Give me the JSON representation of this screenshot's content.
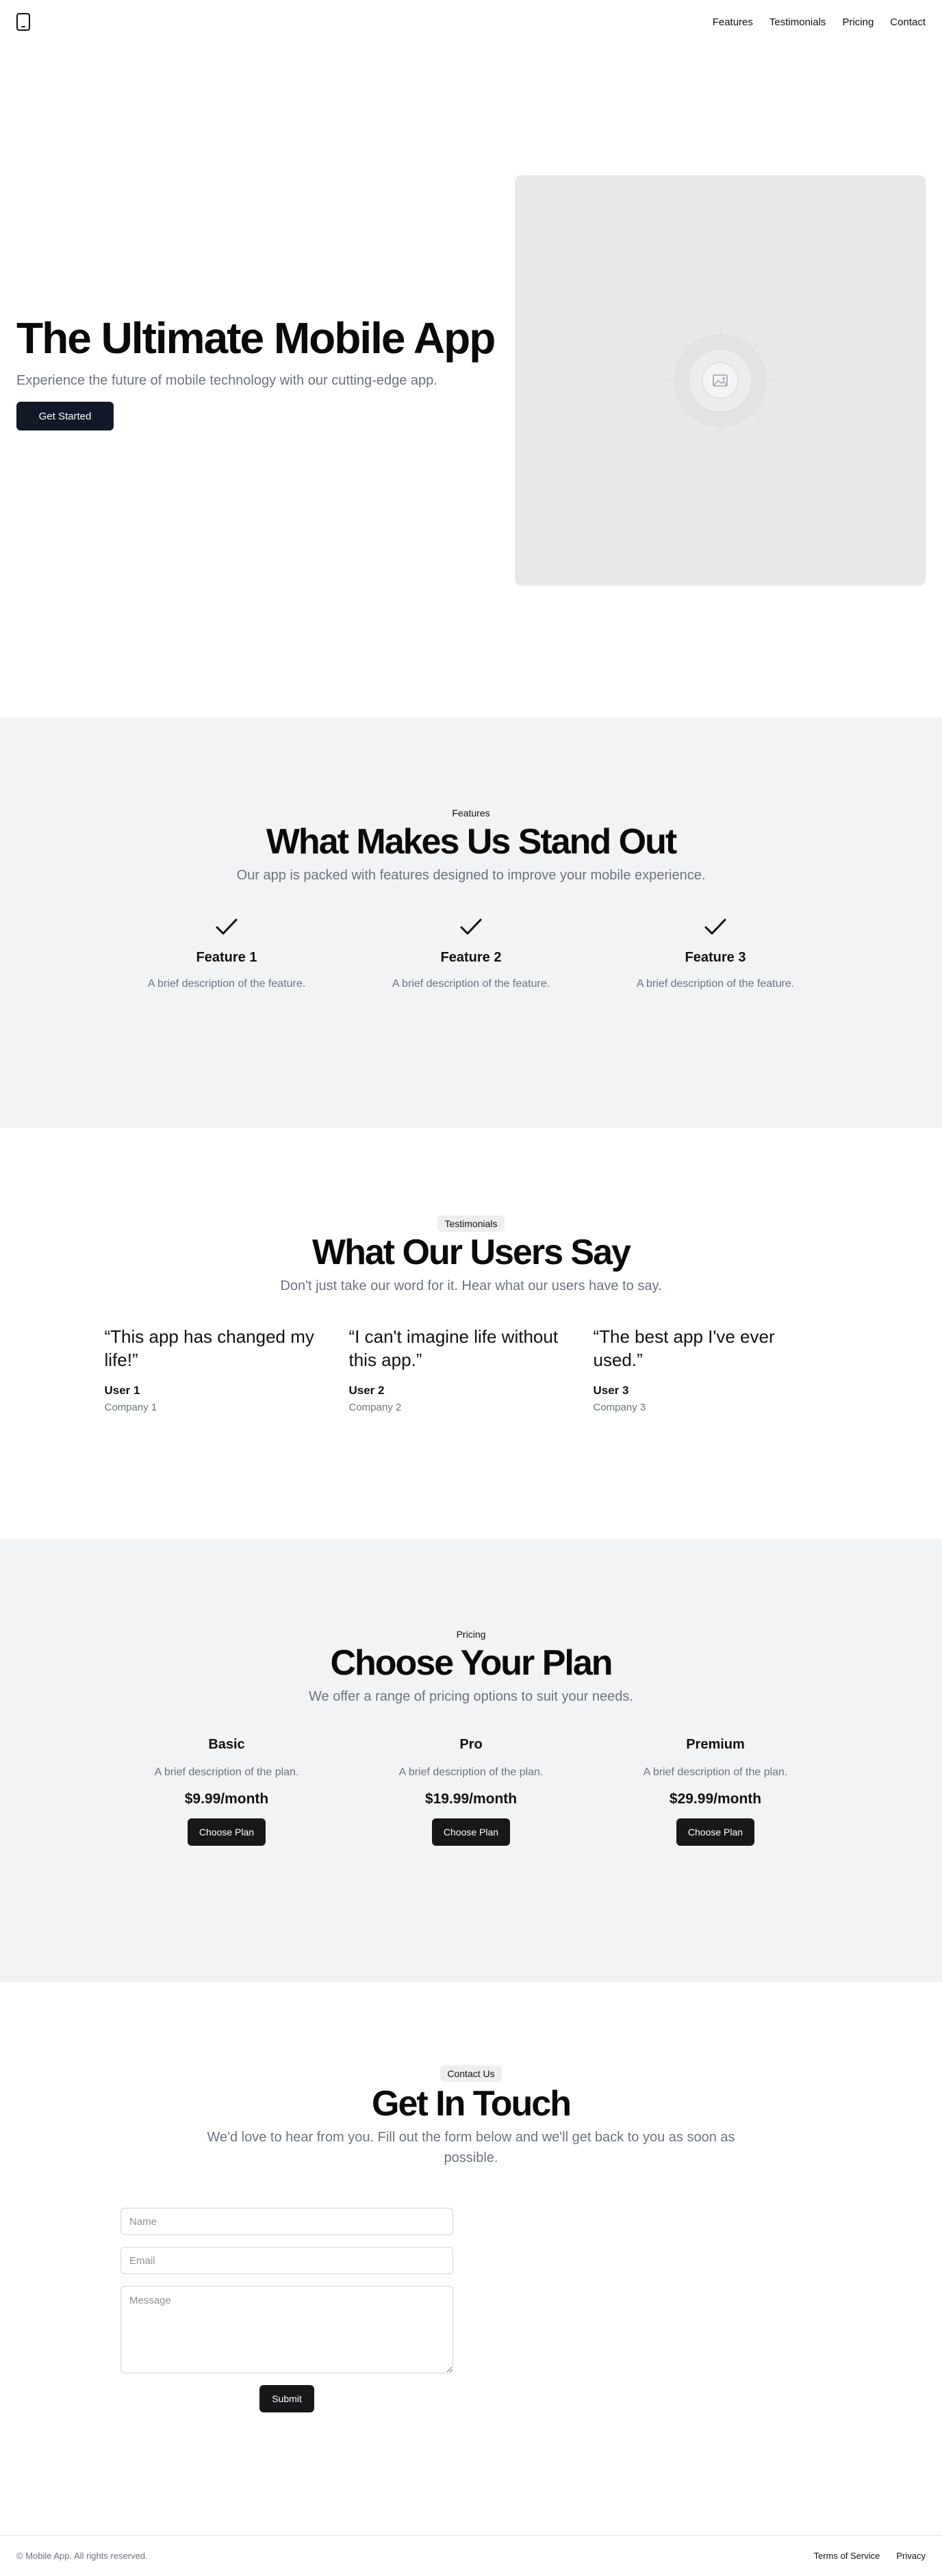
{
  "header": {
    "nav": [
      "Features",
      "Testimonials",
      "Pricing",
      "Contact"
    ]
  },
  "hero": {
    "title": "The Ultimate Mobile App",
    "subtitle": "Experience the future of mobile technology with our cutting-edge app.",
    "cta": "Get Started",
    "image_icon": "image-placeholder-icon"
  },
  "features": {
    "eyebrow": "Features",
    "title": "What Makes Us Stand Out",
    "subtitle": "Our app is packed with features designed to improve your mobile experience.",
    "items": [
      {
        "icon": "check-icon",
        "title": "Feature 1",
        "description": "A brief description of the feature."
      },
      {
        "icon": "check-icon",
        "title": "Feature 2",
        "description": "A brief description of the feature."
      },
      {
        "icon": "check-icon",
        "title": "Feature 3",
        "description": "A brief description of the feature."
      }
    ]
  },
  "testimonials": {
    "eyebrow": "Testimonials",
    "title": "What Our Users Say",
    "subtitle": "Don't just take our word for it. Hear what our users have to say.",
    "items": [
      {
        "quote": "“This app has changed my life!”",
        "name": "User 1",
        "company": "Company 1"
      },
      {
        "quote": "“I can't imagine life without this app.”",
        "name": "User 2",
        "company": "Company 2"
      },
      {
        "quote": "“The best app I've ever used.”",
        "name": "User 3",
        "company": "Company 3"
      }
    ]
  },
  "pricing": {
    "eyebrow": "Pricing",
    "title": "Choose Your Plan",
    "subtitle": "We offer a range of pricing options to suit your needs.",
    "plans": [
      {
        "name": "Basic",
        "description": "A brief description of the plan.",
        "price": "$9.99/month",
        "cta": "Choose Plan"
      },
      {
        "name": "Pro",
        "description": "A brief description of the plan.",
        "price": "$19.99/month",
        "cta": "Choose Plan"
      },
      {
        "name": "Premium",
        "description": "A brief description of the plan.",
        "price": "$29.99/month",
        "cta": "Choose Plan"
      }
    ]
  },
  "contact": {
    "eyebrow": "Contact Us",
    "title": "Get In Touch",
    "subtitle": "We'd love to hear from you. Fill out the form below and we'll get back to you as soon as possible.",
    "form": {
      "name_placeholder": "Name",
      "email_placeholder": "Email",
      "message_placeholder": "Message",
      "submit": "Submit"
    }
  },
  "footer": {
    "copyright": "© Mobile App. All rights reserved.",
    "links": [
      "Terms of Service",
      "Privacy"
    ]
  },
  "colors": {
    "primary_button": "#111827",
    "section_gray": "#f2f3f5",
    "muted_text": "#6b7280"
  }
}
